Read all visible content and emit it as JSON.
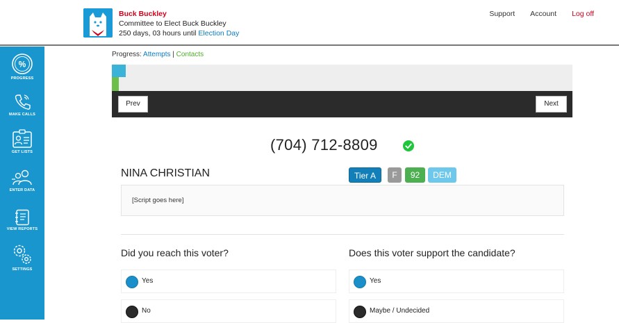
{
  "header": {
    "candidate_name": "Buck Buckley",
    "committee": "Committee to Elect Buck Buckley",
    "countdown_prefix": "250 days, 03 hours until",
    "countdown_link": "Election Day",
    "nav": {
      "support": "Support",
      "account": "Account",
      "logoff": "Log off"
    }
  },
  "sidebar": {
    "items": [
      {
        "label": "PROGRESS",
        "icon": "percent-icon"
      },
      {
        "label": "MAKE CALLS",
        "icon": "phone-icon"
      },
      {
        "label": "GET LISTS",
        "icon": "id-card-icon"
      },
      {
        "label": "ENTER DATA",
        "icon": "people-icon"
      },
      {
        "label": "VIEW REPORTS",
        "icon": "notebook-icon"
      },
      {
        "label": "SETTINGS",
        "icon": "gears-icon"
      }
    ]
  },
  "progress": {
    "label": "Progress:",
    "attempts": "Attempts",
    "separator": "|",
    "contacts": "Contacts"
  },
  "toolbar": {
    "prev": "Prev",
    "next": "Next"
  },
  "voter": {
    "phone": "(704) 712-8809",
    "name": "NINA CHRISTIAN",
    "tier": "Tier A",
    "gender": "F",
    "score": "92",
    "party": "DEM",
    "script": "[Script goes here]"
  },
  "questions": {
    "reach": {
      "text": "Did you reach this voter?",
      "options": [
        "Yes",
        "No"
      ]
    },
    "support": {
      "text": "Does this voter support the candidate?",
      "options": [
        "Yes",
        "Maybe / Undecided"
      ]
    }
  },
  "colors": {
    "brand_blue": "#1a96cf",
    "accent_red": "#d0021b",
    "success_green": "#1fc53a",
    "toolbar_dark": "#2b2b2b"
  }
}
